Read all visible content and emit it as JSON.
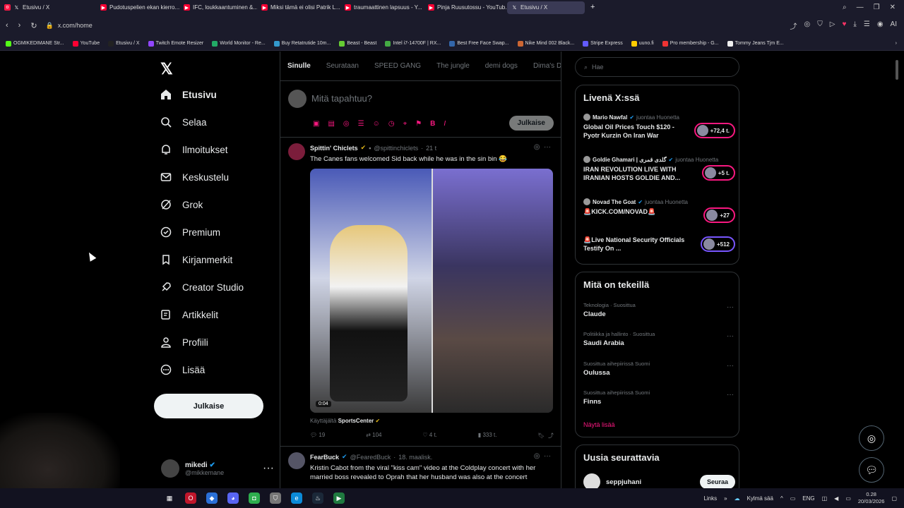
{
  "tabs": [
    {
      "label": "Etusivu / X",
      "color": "#222"
    },
    {
      "label": "Pudotuspelien ekan kierro...",
      "color": "#ff0033"
    },
    {
      "label": "IFC, loukkaantuminen &...",
      "color": "#ff0033"
    },
    {
      "label": "Miksi tämä ei olisi Patrik L...",
      "color": "#ff0033"
    },
    {
      "label": "traumaattinen lapsuus - Y...",
      "color": "#ff0033"
    },
    {
      "label": "Pinja Ruusutossu - YouTub...",
      "color": "#ff0033"
    },
    {
      "label": "Etusivu / X",
      "color": "#222",
      "active": true
    }
  ],
  "address": {
    "url": "x.com/home"
  },
  "bookmarks": [
    {
      "label": "OGMIKEDIMANE Str...",
      "color": "#53fc18"
    },
    {
      "label": "YouTube",
      "color": "#ff0033"
    },
    {
      "label": "Etusivu / X",
      "color": "#222"
    },
    {
      "label": "Twitch Emote Resizer",
      "color": "#9146ff"
    },
    {
      "label": "World Monitor - Re...",
      "color": "#2a6"
    },
    {
      "label": "Buy Retatrutide 10m...",
      "color": "#39c"
    },
    {
      "label": "Beast - Beast",
      "color": "#6c3"
    },
    {
      "label": "Intel i7-14700F | RX...",
      "color": "#4a4"
    },
    {
      "label": "Best Free Face Swap...",
      "color": "#36a"
    },
    {
      "label": "Nike Mind 002 Black...",
      "color": "#c63"
    },
    {
      "label": "Stripe Express",
      "color": "#635bff"
    },
    {
      "label": "uuno.fi",
      "color": "#fc0"
    },
    {
      "label": "Pro membership - G...",
      "color": "#e33"
    },
    {
      "label": "Tommy Jeans Tjm E...",
      "color": "#eee"
    }
  ],
  "nav": {
    "items": [
      {
        "label": "Etusivu",
        "icon": "home-icon"
      },
      {
        "label": "Selaa",
        "icon": "search-icon"
      },
      {
        "label": "Ilmoitukset",
        "icon": "bell-icon"
      },
      {
        "label": "Keskustelu",
        "icon": "mail-icon"
      },
      {
        "label": "Grok",
        "icon": "grok-icon"
      },
      {
        "label": "Premium",
        "icon": "premium-icon"
      },
      {
        "label": "Kirjanmerkit",
        "icon": "bookmark-icon"
      },
      {
        "label": "Creator Studio",
        "icon": "rocket-icon"
      },
      {
        "label": "Artikkelit",
        "icon": "article-icon"
      },
      {
        "label": "Profiili",
        "icon": "profile-icon"
      },
      {
        "label": "Lisää",
        "icon": "more-icon"
      }
    ],
    "post_label": "Julkaise"
  },
  "account": {
    "name": "mikedi",
    "handle": "@mikkemane"
  },
  "feed": {
    "tabs": [
      "Sinulle",
      "Seurataan",
      "SPEED GANG",
      "The jungle",
      "demi dogs",
      "Dima's Dist"
    ],
    "compose_placeholder": "Mitä tapahtuu?",
    "compose_button": "Julkaise",
    "tweets": [
      {
        "name": "Spittin' Chiclets",
        "handle": "@spittinchiclets",
        "time": "21 t",
        "text": "The Canes fans welcomed Sid back while he was in the sin bin 😂",
        "duration": "0:04",
        "via_prefix": "Käyttäjältä",
        "via_name": "SportsCenter",
        "replies": "19",
        "reposts": "104",
        "likes": "4 t.",
        "views": "333 t."
      },
      {
        "name": "FearBuck",
        "handle": "@FearedBuck",
        "time": "18. maalisk.",
        "text": "Kristin Cabot from the viral \"kiss cam\" video at the Coldplay concert with her married boss revealed to Oprah that her husband was also at the concert"
      }
    ]
  },
  "right": {
    "search_placeholder": "Hae",
    "live_title": "Livenä X:ssä",
    "live": [
      {
        "host": "Mario Nawfal",
        "status": "juontaa Huonetta",
        "title": "Global Oil Prices Touch $120 - Pyotr Kurzin On Iran War",
        "count": "+72,4 t."
      },
      {
        "host": "Goldie Ghamari | گلدی قمری",
        "status": "juontaa Huonetta",
        "title": "IRAN REVOLUTION LIVE WITH IRANIAN HOSTS GOLDIE AND...",
        "count": "+5 t."
      },
      {
        "host": "Novad The Goat",
        "status": "juontaa Huonetta",
        "title": "🚨KICK.COM/NOVAD🚨",
        "count": "+27"
      },
      {
        "host": "",
        "status": "",
        "title": "🚨Live National Security Officials Testify On ...",
        "count": "+512"
      }
    ],
    "trends_title": "Mitä on tekeillä",
    "trends": [
      {
        "category": "Teknologia · Suosittua",
        "topic": "Claude"
      },
      {
        "category": "Politiikka ja hallinto · Suosittua",
        "topic": "Saudi Arabia"
      },
      {
        "category": "Suosittua aihepiirissä Suomi",
        "topic": "Oulussa"
      },
      {
        "category": "Suosittua aihepiirissä Suomi",
        "topic": "Finns"
      }
    ],
    "show_more": "Näytä lisää",
    "follow_title": "Uusia seurattavia",
    "follow": {
      "name": "seppjuhani",
      "button": "Seuraa"
    }
  },
  "taskbar": {
    "links": "Links",
    "weather": "Kylmä sää",
    "lang": "ENG",
    "time": "0.28",
    "date": "20/03/2026"
  },
  "colors": {
    "accent": "#f91880",
    "background": "#000000",
    "border": "#2f3336"
  }
}
